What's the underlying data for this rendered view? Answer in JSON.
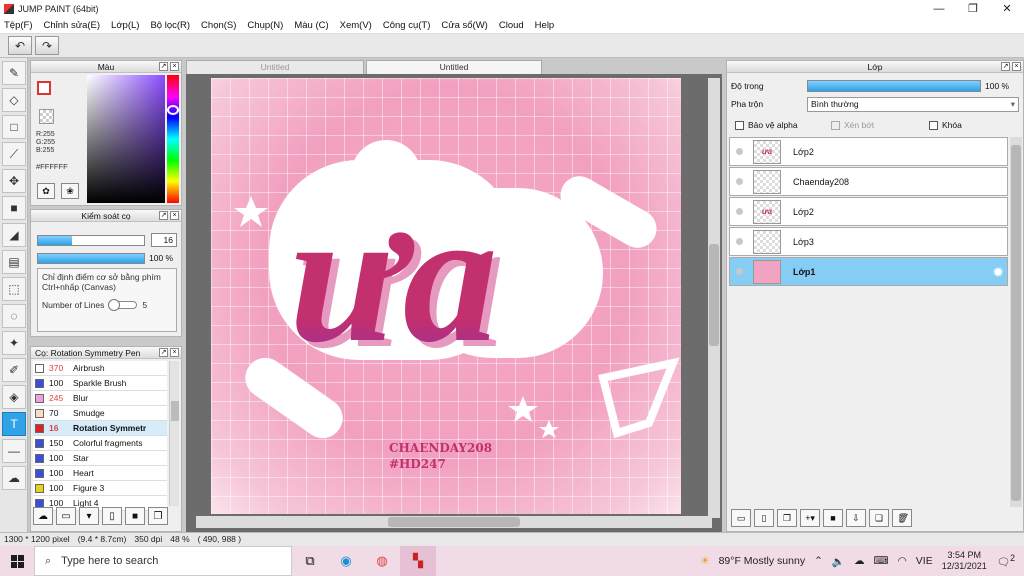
{
  "window": {
    "title": "JUMP PAINT (64bit)"
  },
  "menu": [
    "Tệp(F)",
    "Chỉnh sửa(E)",
    "Lớp(L)",
    "Bộ lọc(R)",
    "Chọn(S)",
    "Chụp(N)",
    "Màu (C)",
    "Xem(V)",
    "Công cụ(T)",
    "Cửa sổ(W)",
    "Cloud",
    "Help"
  ],
  "color_panel": {
    "title": "Màu",
    "rgb": [
      "R:255",
      "G:255",
      "B:255"
    ],
    "hex": "#FFFFFF"
  },
  "brush_control": {
    "title": "Kiểm soát cọ",
    "size": "16",
    "opacity": "100 %",
    "hint": "Chỉ định điểm cơ sở bằng phím Ctrl+nhấp (Canvas)",
    "lines_label": "Number of Lines",
    "lines_value": "5"
  },
  "brush_list": {
    "title": "Cọ: Rotation Symmetry Pen",
    "items": [
      {
        "size": "370",
        "name": "Airbrush",
        "color": "#ffffff",
        "red": true
      },
      {
        "size": "100",
        "name": "Sparkle Brush",
        "color": "#3a4fd8",
        "red": false
      },
      {
        "size": "245",
        "name": "Blur",
        "color": "#f0a0d8",
        "red": true
      },
      {
        "size": "70",
        "name": "Smudge",
        "color": "#f8dcc8",
        "red": false
      },
      {
        "size": "16",
        "name": "Rotation Symmetr",
        "color": "#e02020",
        "red": true,
        "selected": true
      },
      {
        "size": "150",
        "name": "Colorful fragments",
        "color": "#3a4fd8",
        "red": false
      },
      {
        "size": "100",
        "name": "Star",
        "color": "#3a4fd8",
        "red": false
      },
      {
        "size": "100",
        "name": "Heart",
        "color": "#3a4fd8",
        "red": false
      },
      {
        "size": "100",
        "name": "Figure 3",
        "color": "#e8d020",
        "red": false
      },
      {
        "size": "100",
        "name": "Light 4",
        "color": "#3a4fd8",
        "red": false
      }
    ]
  },
  "tabs": [
    "Untitled",
    "Untitled"
  ],
  "artwork": {
    "title_text": "ưa",
    "credit_1": "CHAENDAY208",
    "credit_2": "#HD247"
  },
  "layer_panel": {
    "title": "Lớp",
    "opacity_label": "Độ trong",
    "opacity_value": "100 %",
    "blend_label": "Pha trộn",
    "blend_value": "Bình thường",
    "protect_alpha": "Bảo vệ alpha",
    "clipping": "Xén bớt",
    "lock": "Khóa",
    "layers": [
      {
        "name": "Lớp2",
        "thumb": "ưa"
      },
      {
        "name": "Chaenday208",
        "thumb": ""
      },
      {
        "name": "Lớp2",
        "thumb": "ưa"
      },
      {
        "name": "Lớp3",
        "thumb": ""
      },
      {
        "name": "Lớp1",
        "thumb": "",
        "selected": true
      }
    ]
  },
  "status": {
    "size": "1300 * 1200 pixel",
    "physical": "(9.4 * 8.7cm)",
    "dpi": "350 dpi",
    "zoom": "48 %",
    "cursor": "( 490, 988 )"
  },
  "taskbar": {
    "search_placeholder": "Type here to search",
    "weather": "89°F  Mostly sunny",
    "lang": "VIE",
    "time": "3:54 PM",
    "date": "12/31/2021",
    "notifications": "2"
  },
  "colors": {
    "accent": "#2fa3e6",
    "canvas_pink": "#f2a0c0",
    "taskbar": "#f0dbe6"
  }
}
